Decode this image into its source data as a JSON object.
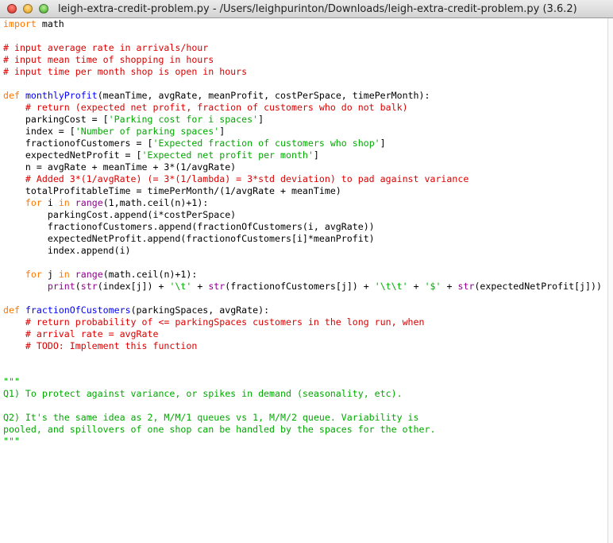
{
  "window": {
    "title": "leigh-extra-credit-problem.py - /Users/leighpurinton/Downloads/leigh-extra-credit-problem.py (3.6.2)"
  },
  "colors": {
    "keyword": "#ff7700",
    "comment": "#dd0000",
    "string": "#00aa00",
    "definition": "#0000ff",
    "builtin": "#900090"
  },
  "code_lines": [
    [
      [
        "k",
        "import"
      ],
      [
        "t",
        " math"
      ]
    ],
    [],
    [
      [
        "c",
        "# input average rate in arrivals/hour"
      ]
    ],
    [
      [
        "c",
        "# input mean time of shopping in hours"
      ]
    ],
    [
      [
        "c",
        "# input time per month shop is open in hours"
      ]
    ],
    [],
    [
      [
        "k",
        "def"
      ],
      [
        "t",
        " "
      ],
      [
        "f",
        "monthlyProfit"
      ],
      [
        "t",
        "(meanTime, avgRate, meanProfit, costPerSpace, timePerMonth):"
      ]
    ],
    [
      [
        "t",
        "    "
      ],
      [
        "c",
        "# return (expected net profit, fraction of customers who do not balk)"
      ]
    ],
    [
      [
        "t",
        "    parkingCost = ["
      ],
      [
        "s",
        "'Parking cost for i spaces'"
      ],
      [
        "t",
        "]"
      ]
    ],
    [
      [
        "t",
        "    index = ["
      ],
      [
        "s",
        "'Number of parking spaces'"
      ],
      [
        "t",
        "]"
      ]
    ],
    [
      [
        "t",
        "    fractionofCustomers = ["
      ],
      [
        "s",
        "'Expected fraction of customers who shop'"
      ],
      [
        "t",
        "]"
      ]
    ],
    [
      [
        "t",
        "    expectedNetProfit = ["
      ],
      [
        "s",
        "'Expected net profit per month'"
      ],
      [
        "t",
        "]"
      ]
    ],
    [
      [
        "t",
        "    n = avgRate + meanTime + 3*(1/avgRate)"
      ]
    ],
    [
      [
        "t",
        "    "
      ],
      [
        "c",
        "# Added 3*(1/avgRate) (= 3*(1/lambda) = 3*std deviation) to pad against variance"
      ]
    ],
    [
      [
        "t",
        "    totalProfitableTime = timePerMonth/(1/avgRate + meanTime)"
      ]
    ],
    [
      [
        "t",
        "    "
      ],
      [
        "k",
        "for"
      ],
      [
        "t",
        " i "
      ],
      [
        "k",
        "in"
      ],
      [
        "t",
        " "
      ],
      [
        "b",
        "range"
      ],
      [
        "t",
        "(1,math.ceil(n)+1):"
      ]
    ],
    [
      [
        "t",
        "        parkingCost.append(i*costPerSpace)"
      ]
    ],
    [
      [
        "t",
        "        fractionofCustomers.append(fractionOfCustomers(i, avgRate))"
      ]
    ],
    [
      [
        "t",
        "        expectedNetProfit.append(fractionofCustomers[i]*meanProfit)"
      ]
    ],
    [
      [
        "t",
        "        index.append(i)"
      ]
    ],
    [],
    [
      [
        "t",
        "    "
      ],
      [
        "k",
        "for"
      ],
      [
        "t",
        " j "
      ],
      [
        "k",
        "in"
      ],
      [
        "t",
        " "
      ],
      [
        "b",
        "range"
      ],
      [
        "t",
        "(math.ceil(n)+1):"
      ]
    ],
    [
      [
        "t",
        "        "
      ],
      [
        "b",
        "print"
      ],
      [
        "t",
        "("
      ],
      [
        "b",
        "str"
      ],
      [
        "t",
        "(index[j]) + "
      ],
      [
        "s",
        "'\\t'"
      ],
      [
        "t",
        " + "
      ],
      [
        "b",
        "str"
      ],
      [
        "t",
        "(fractionofCustomers[j]) + "
      ],
      [
        "s",
        "'\\t\\t'"
      ],
      [
        "t",
        " + "
      ],
      [
        "s",
        "'$'"
      ],
      [
        "t",
        " + "
      ],
      [
        "b",
        "str"
      ],
      [
        "t",
        "(expectedNetProfit[j]))"
      ]
    ],
    [],
    [
      [
        "k",
        "def"
      ],
      [
        "t",
        " "
      ],
      [
        "f",
        "fractionOfCustomers"
      ],
      [
        "t",
        "(parkingSpaces, avgRate):"
      ]
    ],
    [
      [
        "t",
        "    "
      ],
      [
        "c",
        "# return probability of <= parkingSpaces customers in the long run, when"
      ]
    ],
    [
      [
        "t",
        "    "
      ],
      [
        "c",
        "# arrival rate = avgRate"
      ]
    ],
    [
      [
        "t",
        "    "
      ],
      [
        "c",
        "# TODO: Implement this function"
      ]
    ],
    [],
    [],
    [
      [
        "s",
        "\"\"\""
      ]
    ],
    [
      [
        "s",
        "Q1) To protect against variance, or spikes in demand (seasonality, etc)."
      ]
    ],
    [],
    [
      [
        "s",
        "Q2) It's the same idea as 2, M/M/1 queues vs 1, M/M/2 queue. Variability is"
      ]
    ],
    [
      [
        "s",
        "pooled, and spillovers of one shop can be handled by the spaces for the other."
      ]
    ],
    [
      [
        "s",
        "\"\"\""
      ]
    ]
  ]
}
